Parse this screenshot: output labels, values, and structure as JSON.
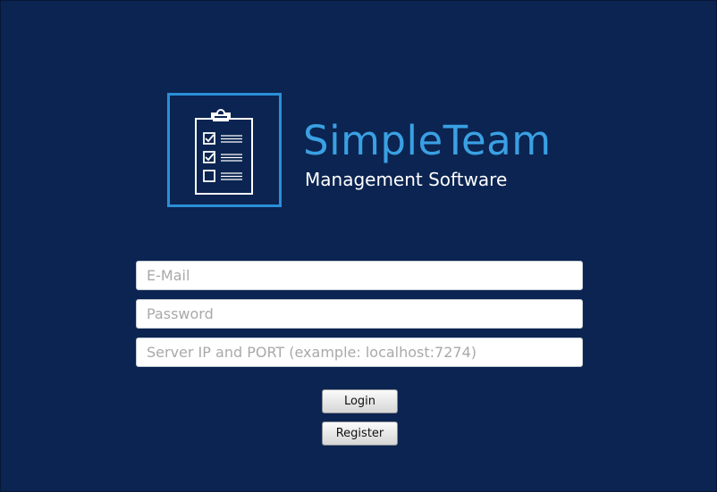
{
  "brand": {
    "title": "SimpleTeam",
    "subtitle": "Management Software",
    "logo_icon": "clipboard-checklist-icon",
    "accent_color": "#3aa0e3",
    "background_color": "#0b2451"
  },
  "form": {
    "email_placeholder": "E-Mail",
    "password_placeholder": "Password",
    "server_placeholder": "Server IP and PORT (example: localhost:7274)",
    "login_label": "Login",
    "register_label": "Register"
  }
}
